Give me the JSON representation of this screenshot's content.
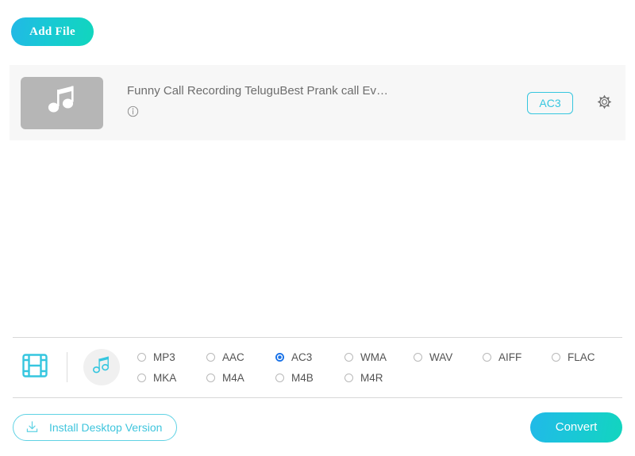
{
  "toolbar": {
    "add_file_label": "Add File"
  },
  "file_list": {
    "items": [
      {
        "title": "Funny Call Recording TeluguBest Prank call Ev…",
        "thumb_icon": "music-note-icon",
        "info_icon": "info-icon",
        "format_label": "AC3",
        "settings_icon": "gear-icon"
      }
    ]
  },
  "format_bar": {
    "tabs": [
      {
        "name": "video",
        "icon": "film-strip-icon",
        "active": false
      },
      {
        "name": "audio",
        "icon": "music-note-icon",
        "active": true
      }
    ],
    "options_row1": [
      {
        "label": "MP3",
        "selected": false
      },
      {
        "label": "AAC",
        "selected": false
      },
      {
        "label": "AC3",
        "selected": true
      },
      {
        "label": "WMA",
        "selected": false
      },
      {
        "label": "WAV",
        "selected": false
      },
      {
        "label": "AIFF",
        "selected": false
      },
      {
        "label": "FLAC",
        "selected": false
      }
    ],
    "options_row2": [
      {
        "label": "MKA",
        "selected": false
      },
      {
        "label": "M4A",
        "selected": false
      },
      {
        "label": "M4B",
        "selected": false
      },
      {
        "label": "M4R",
        "selected": false
      }
    ]
  },
  "action_bar": {
    "install_label": "Install Desktop Version",
    "install_icon": "download-icon",
    "convert_label": "Convert"
  },
  "colors": {
    "accent_cyan": "#35c6df",
    "gradient_start": "#21b9e8",
    "gradient_end": "#12d5be",
    "radio_selected_blue": "#1a73e8",
    "row_background": "#f7f7f7",
    "thumb_gray": "#b6b6b6"
  }
}
